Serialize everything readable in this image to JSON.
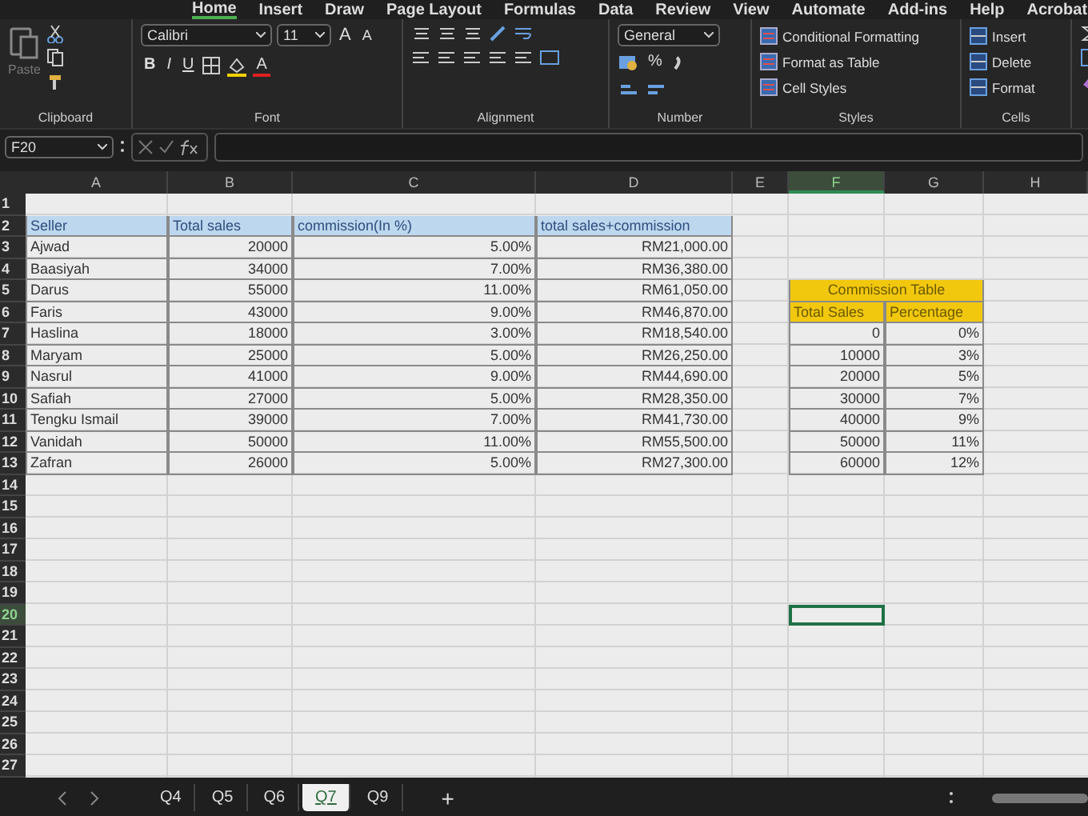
{
  "ribbon_tabs": [
    {
      "label": "Home",
      "selected": true
    },
    {
      "label": "Insert",
      "selected": false
    },
    {
      "label": "Draw",
      "selected": false
    },
    {
      "label": "Page Layout",
      "selected": false
    },
    {
      "label": "Formulas",
      "selected": false
    },
    {
      "label": "Data",
      "selected": false
    },
    {
      "label": "Review",
      "selected": false
    },
    {
      "label": "View",
      "selected": false
    },
    {
      "label": "Automate",
      "selected": false
    },
    {
      "label": "Add-ins",
      "selected": false
    },
    {
      "label": "Help",
      "selected": false
    },
    {
      "label": "Acrobat",
      "selected": false
    }
  ],
  "ribbon": {
    "clipboard": {
      "label": "Clipboard",
      "paste": "Paste"
    },
    "font": {
      "label": "Font",
      "family": "Calibri",
      "size": "11",
      "grow": "A",
      "shrink": "A",
      "style_buttons": [
        "B",
        "I",
        "U"
      ],
      "font_color": "A"
    },
    "alignment": {
      "label": "Alignment"
    },
    "number": {
      "label": "Number",
      "format": "General",
      "percent": "%"
    },
    "styles": {
      "label": "Styles",
      "items": [
        "Conditional Formatting",
        "Format as Table",
        "Cell Styles"
      ]
    },
    "cells": {
      "label": "Cells",
      "items": [
        "Insert",
        "Delete",
        "Format"
      ]
    }
  },
  "formula_bar": {
    "name_box": "F20"
  },
  "sheet": {
    "columns": [
      {
        "label": "A",
        "selected": false
      },
      {
        "label": "B",
        "selected": false
      },
      {
        "label": "C",
        "selected": false
      },
      {
        "label": "D",
        "selected": false
      },
      {
        "label": "E",
        "selected": false
      },
      {
        "label": "F",
        "selected": true
      },
      {
        "label": "G",
        "selected": false
      },
      {
        "label": "H",
        "selected": false
      }
    ],
    "rows": [
      {
        "label": "1",
        "selected": false
      },
      {
        "label": "2",
        "selected": false
      },
      {
        "label": "3",
        "selected": false
      },
      {
        "label": "4",
        "selected": false
      },
      {
        "label": "5",
        "selected": false
      },
      {
        "label": "6",
        "selected": false
      },
      {
        "label": "7",
        "selected": false
      },
      {
        "label": "8",
        "selected": false
      },
      {
        "label": "9",
        "selected": false
      },
      {
        "label": "10",
        "selected": false
      },
      {
        "label": "11",
        "selected": false
      },
      {
        "label": "12",
        "selected": false
      },
      {
        "label": "13",
        "selected": false
      },
      {
        "label": "14",
        "selected": false
      },
      {
        "label": "15",
        "selected": false
      },
      {
        "label": "16",
        "selected": false
      },
      {
        "label": "17",
        "selected": false
      },
      {
        "label": "18",
        "selected": false
      },
      {
        "label": "19",
        "selected": false
      },
      {
        "label": "20",
        "selected": true
      },
      {
        "label": "21",
        "selected": false
      },
      {
        "label": "22",
        "selected": false
      },
      {
        "label": "23",
        "selected": false
      },
      {
        "label": "24",
        "selected": false
      },
      {
        "label": "25",
        "selected": false
      },
      {
        "label": "26",
        "selected": false
      },
      {
        "label": "27",
        "selected": false
      }
    ],
    "sales_table": {
      "columns": [
        "Seller",
        "Total sales",
        "commission(In %)",
        "total sales+commission"
      ],
      "rows": [
        [
          "Ajwad",
          "20000",
          "5.00%",
          "RM21,000.00"
        ],
        [
          "Baasiyah",
          "34000",
          "7.00%",
          "RM36,380.00"
        ],
        [
          "Darus",
          "55000",
          "11.00%",
          "RM61,050.00"
        ],
        [
          "Faris",
          "43000",
          "9.00%",
          "RM46,870.00"
        ],
        [
          "Haslina",
          "18000",
          "3.00%",
          "RM18,540.00"
        ],
        [
          "Maryam",
          "25000",
          "5.00%",
          "RM26,250.00"
        ],
        [
          "Nasrul",
          "41000",
          "9.00%",
          "RM44,690.00"
        ],
        [
          "Safiah",
          "27000",
          "5.00%",
          "RM28,350.00"
        ],
        [
          "Tengku Ismail",
          "39000",
          "7.00%",
          "RM41,730.00"
        ],
        [
          "Vanidah",
          "50000",
          "11.00%",
          "RM55,500.00"
        ],
        [
          "Zafran",
          "26000",
          "5.00%",
          "RM27,300.00"
        ]
      ]
    },
    "commission_table": {
      "title": "Commission Table",
      "columns": [
        "Total Sales",
        "Percentage"
      ],
      "rows": [
        [
          "0",
          "0%"
        ],
        [
          "10000",
          "3%"
        ],
        [
          "20000",
          "5%"
        ],
        [
          "30000",
          "7%"
        ],
        [
          "40000",
          "9%"
        ],
        [
          "50000",
          "11%"
        ],
        [
          "60000",
          "12%"
        ]
      ]
    }
  },
  "sheet_tabs": [
    {
      "label": "Q4",
      "selected": false
    },
    {
      "label": "Q5",
      "selected": false
    },
    {
      "label": "Q6",
      "selected": false
    },
    {
      "label": "Q7",
      "selected": true
    },
    {
      "label": "Q9",
      "selected": false
    }
  ],
  "add_sheet": "+"
}
